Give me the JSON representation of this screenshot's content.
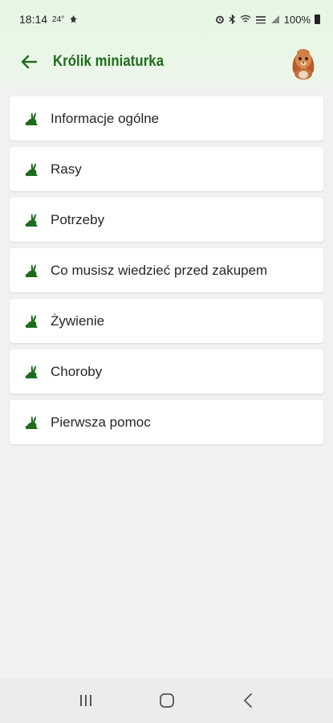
{
  "status_bar": {
    "time": "18:14",
    "temperature": "24°",
    "battery": "100%",
    "icons": [
      "alarm-icon",
      "bluetooth-icon",
      "wifi-icon",
      "lte-icon",
      "signal-icon",
      "battery-icon"
    ]
  },
  "app_bar": {
    "title": "Królik miniaturka",
    "back_icon": "arrow-left-icon",
    "avatar": "rabbit-avatar"
  },
  "menu": {
    "items": [
      {
        "label": "Informacje ogólne",
        "icon": "rabbit-icon"
      },
      {
        "label": "Rasy",
        "icon": "rabbit-icon"
      },
      {
        "label": "Potrzeby",
        "icon": "rabbit-icon"
      },
      {
        "label": "Co musisz wiedzieć przed zakupem",
        "icon": "rabbit-icon"
      },
      {
        "label": "Żywienie",
        "icon": "rabbit-icon"
      },
      {
        "label": "Choroby",
        "icon": "rabbit-icon"
      },
      {
        "label": "Pierwsza pomoc",
        "icon": "rabbit-icon"
      }
    ]
  },
  "nav_bar": {
    "buttons": [
      "recent-apps-icon",
      "home-icon",
      "back-icon"
    ]
  },
  "colors": {
    "accent": "#1e6b1c",
    "header_bg": "#e6f6e4",
    "page_bg": "#f1f1f1"
  }
}
